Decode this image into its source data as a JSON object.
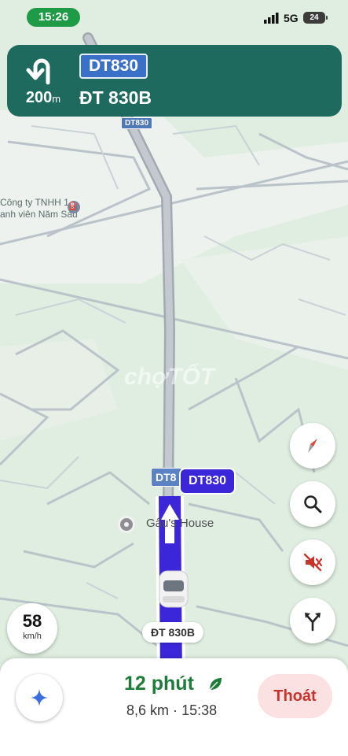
{
  "status_bar": {
    "time": "15:26",
    "network": "5G",
    "battery": "24"
  },
  "navigation": {
    "distance_value": "200",
    "distance_unit": "m",
    "road_code": "DT830",
    "road_name": "ĐT 830B"
  },
  "map": {
    "top_shield": "DT830",
    "place_line1": "Công ty TNHH 1",
    "place_line2": "anh viên Năm Sáu",
    "route_shield_partial": "DT8",
    "route_callout": "DT830",
    "poi_name": "Gấu's House",
    "street_label": "ĐT 830B",
    "watermark": "chợTỐT",
    "route_color": "#3b27d9"
  },
  "speed": {
    "value": "58",
    "unit": "km/h"
  },
  "controls": [
    {
      "name": "compass-button",
      "icon": "compass-icon"
    },
    {
      "name": "search-button",
      "icon": "search-icon"
    },
    {
      "name": "mute-button",
      "icon": "mute-icon"
    },
    {
      "name": "alternate-routes-button",
      "icon": "fork-icon"
    }
  ],
  "trip": {
    "eta_time": "12 phút",
    "distance": "8,6 km",
    "separator": "·",
    "arrival": "15:38",
    "exit_label": "Thoát"
  }
}
